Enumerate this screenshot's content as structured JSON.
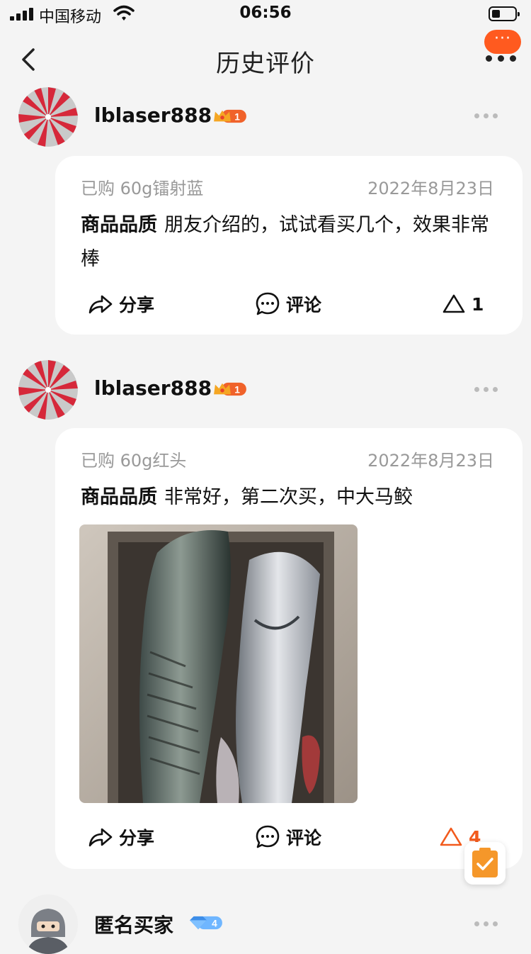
{
  "status_bar": {
    "carrier": "中国移动",
    "time": "06:56"
  },
  "nav": {
    "title": "历史评价",
    "bubble_text": "···"
  },
  "reviews": [
    {
      "user": "lblaser888",
      "badge_level": "1",
      "spec": "已购 60g镭射蓝",
      "date": "2022年8月23日",
      "tag": "商品品质",
      "text": "朋友介绍的，试试看买几个，效果非常棒",
      "share_label": "分享",
      "comment_label": "评论",
      "like_count": "1",
      "has_photo": false
    },
    {
      "user": "lblaser888",
      "badge_level": "1",
      "spec": "已购 60g红头",
      "date": "2022年8月23日",
      "tag": "商品品质",
      "text": "非常好，第二次买，中大马鲛",
      "share_label": "分享",
      "comment_label": "评论",
      "like_count": "4",
      "has_photo": true
    },
    {
      "user": "匿名买家",
      "badge_level": "4"
    }
  ],
  "colors": {
    "accent": "#ff5a1f",
    "liked": "#f25a1c",
    "badge_gold": "#f5a623",
    "badge_blue": "#6fb6ff"
  }
}
